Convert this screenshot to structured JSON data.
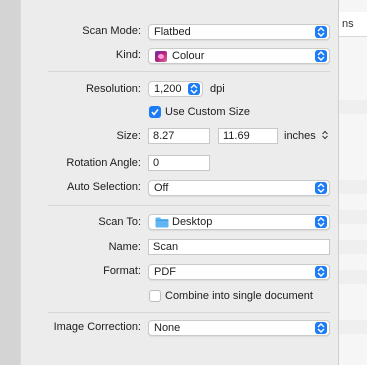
{
  "scan": {
    "scan_mode": {
      "label": "Scan Mode:",
      "value": "Flatbed"
    },
    "kind": {
      "label": "Kind:",
      "value": "Colour",
      "icon": "colour-swatch-icon"
    },
    "resolution": {
      "label": "Resolution:",
      "value": "1,200",
      "unit": "dpi"
    },
    "custom_size": {
      "label": "Use Custom Size",
      "checked": true
    },
    "size": {
      "label": "Size:",
      "width": "8.27",
      "height": "11.69",
      "units": "inches"
    },
    "rotation": {
      "label": "Rotation Angle:",
      "value": "0"
    },
    "auto_selection": {
      "label": "Auto Selection:",
      "value": "Off"
    },
    "scan_to": {
      "label": "Scan To:",
      "value": "Desktop",
      "icon": "folder-icon"
    },
    "name": {
      "label": "Name:",
      "value": "Scan"
    },
    "format": {
      "label": "Format:",
      "value": "PDF"
    },
    "combine": {
      "label": "Combine into single document",
      "checked": false
    },
    "image_correction": {
      "label": "Image Correction:",
      "value": "None"
    }
  },
  "background": {
    "tab_fragment": "ns"
  },
  "colors": {
    "accent": "#1b7cf6",
    "panel": "#ececec"
  }
}
